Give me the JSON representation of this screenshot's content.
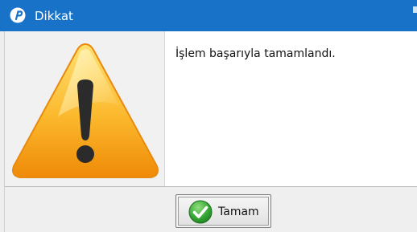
{
  "window": {
    "title": "Dikkat",
    "icon": "app-logo-icon",
    "title_bar_color": "#1873c8"
  },
  "dialog": {
    "icon": "warning-icon",
    "message": "İşlem başarıyla tamamlandı."
  },
  "buttons": {
    "ok_label": "Tamam",
    "ok_icon": "checkmark-icon"
  },
  "colors": {
    "warning_orange": "#f7a21b",
    "check_green": "#2f9e2f"
  }
}
